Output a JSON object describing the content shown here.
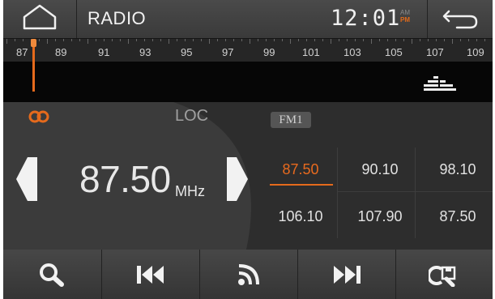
{
  "header": {
    "title": "RADIO",
    "clock": "12:01",
    "am_label": "AM",
    "pm_label": "PM"
  },
  "tuner": {
    "scale_labels": [
      "87",
      "89",
      "91",
      "93",
      "95",
      "97",
      "99",
      "101",
      "103",
      "105",
      "107",
      "109"
    ],
    "current_position": 87.5
  },
  "status": {
    "loc_label": "LOC",
    "band": "FM1"
  },
  "frequency": {
    "value": "87.50",
    "unit": "MHz"
  },
  "presets": [
    {
      "value": "87.50",
      "active": true
    },
    {
      "value": "90.10",
      "active": false
    },
    {
      "value": "98.10",
      "active": false
    },
    {
      "value": "106.10",
      "active": false
    },
    {
      "value": "107.90",
      "active": false
    },
    {
      "value": "87.50",
      "active": false
    }
  ],
  "colors": {
    "accent": "#e56a1c",
    "background": "#151515"
  },
  "icons": [
    "home-icon",
    "back-icon",
    "stereo-icon",
    "equalizer-icon",
    "search-icon",
    "previous-icon",
    "scan-icon",
    "next-icon",
    "save-icon"
  ]
}
